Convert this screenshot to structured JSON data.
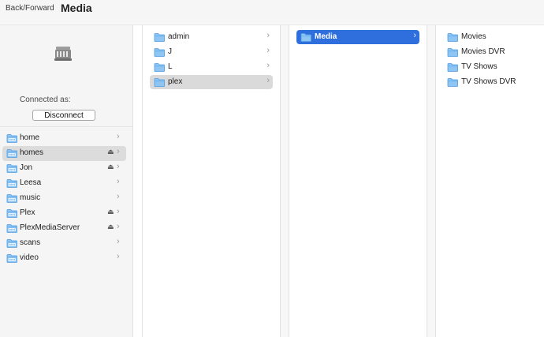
{
  "toolbar": {
    "nav_label": "Back/Forward",
    "title": "Media"
  },
  "server": {
    "connected_label": "Connected as:",
    "disconnect_label": "Disconnect"
  },
  "sidebar": {
    "items": [
      {
        "label": "home",
        "eject": false
      },
      {
        "label": "homes",
        "eject": true,
        "selected": true
      },
      {
        "label": "Jon",
        "eject": true
      },
      {
        "label": "Leesa",
        "eject": false
      },
      {
        "label": "music",
        "eject": false
      },
      {
        "label": "Plex",
        "eject": true
      },
      {
        "label": "PlexMediaServer",
        "eject": true
      },
      {
        "label": "scans",
        "eject": false
      },
      {
        "label": "video",
        "eject": false
      }
    ]
  },
  "columns": {
    "col1": [
      {
        "label": "admin"
      },
      {
        "label": "J"
      },
      {
        "label": "L"
      },
      {
        "label": "plex",
        "selected": true
      }
    ],
    "col2": [
      {
        "label": "Media",
        "selected": true
      }
    ],
    "col3": [
      {
        "label": "Movies"
      },
      {
        "label": "Movies DVR"
      },
      {
        "label": "TV Shows"
      },
      {
        "label": "TV Shows DVR"
      }
    ]
  },
  "glyphs": {
    "chevron": "›",
    "eject": "⏏"
  },
  "colors": {
    "folder_fill": "#8ec5f3",
    "folder_tab": "#6cb0ec",
    "folder_stroke": "#4d9be2",
    "selection_blue": "#2f6fdd",
    "selection_gray": "#dadada"
  }
}
